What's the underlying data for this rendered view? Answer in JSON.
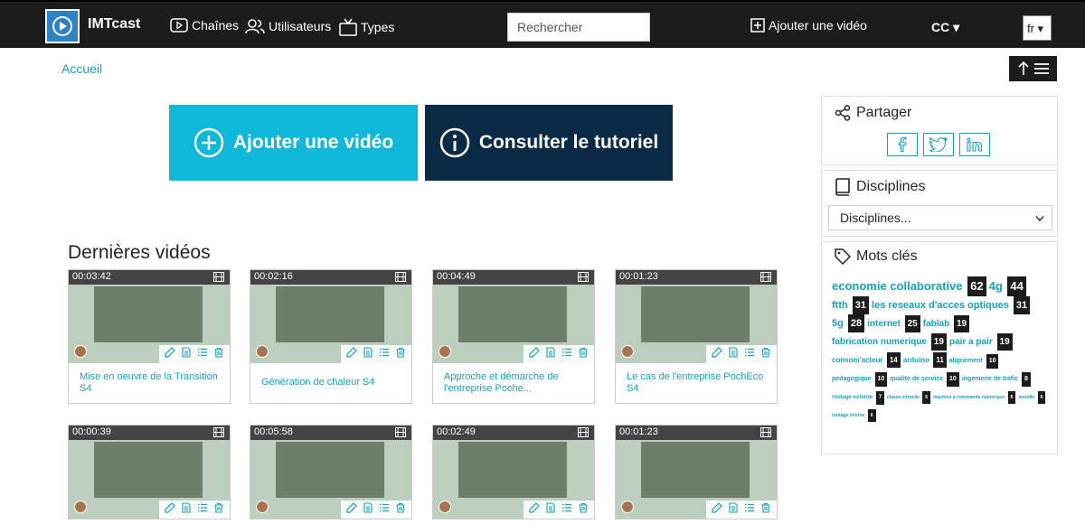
{
  "navbar": {
    "brand": "IMTcast",
    "items": [
      {
        "label": "Chaînes",
        "icon": "play-icon"
      },
      {
        "label": "Utilisateurs",
        "icon": "users-icon"
      },
      {
        "label": "Types",
        "icon": "tv-icon"
      }
    ],
    "search_placeholder": "Rechercher",
    "add_video": "Ajouter une vidéo",
    "cc": "CC ▾",
    "lang": "fr ▾"
  },
  "breadcrumb": "Accueil",
  "buttons": {
    "add": "Ajouter une vidéo",
    "tutorial": "Consulter le tutoriel"
  },
  "section_title": "Dernières vidéos",
  "videos": [
    {
      "duration": "00:03:42",
      "title": "Mise en oeuvre de la Transition S4"
    },
    {
      "duration": "00:02:16",
      "title": "Génération de chaleur S4"
    },
    {
      "duration": "00:04:49",
      "title": "Approche et démarche de l'entreprise Poche..."
    },
    {
      "duration": "00:01:23",
      "title": "Le cas de l'entreprise PochEco S4"
    },
    {
      "duration": "00:00:39",
      "title": ""
    },
    {
      "duration": "00:05:58",
      "title": ""
    },
    {
      "duration": "00:02:49",
      "title": ""
    },
    {
      "duration": "00:01:23",
      "title": ""
    }
  ],
  "sidebar": {
    "share_title": "Partager",
    "share_icons": [
      "facebook-icon",
      "twitter-icon",
      "linkedin-icon"
    ],
    "disciplines_title": "Disciplines",
    "disciplines_select": "Disciplines...",
    "keywords_title": "Mots clés",
    "keywords": [
      {
        "label": "economie collaborative",
        "count": "62",
        "size": 13
      },
      {
        "label": "4g",
        "count": "44",
        "size": 13
      },
      {
        "label": "ftth",
        "count": "31",
        "size": 11
      },
      {
        "label": "les reseaux d'acces optiques",
        "count": "31",
        "size": 11
      },
      {
        "label": "5g",
        "count": "28",
        "size": 11
      },
      {
        "label": "internet",
        "count": "25",
        "size": 10
      },
      {
        "label": "fablab",
        "count": "19",
        "size": 10
      },
      {
        "label": "fabrication numerique",
        "count": "19",
        "size": 10
      },
      {
        "label": "pair a pair",
        "count": "19",
        "size": 10
      },
      {
        "label": "consom'acteur",
        "count": "14",
        "size": 8
      },
      {
        "label": "arduino",
        "count": "11",
        "size": 8
      },
      {
        "label": "alignement",
        "count": "10",
        "size": 7
      },
      {
        "label": "pedagogique",
        "count": "10",
        "size": 7
      },
      {
        "label": "qualite de service",
        "count": "10",
        "size": 7
      },
      {
        "label": "ingenierie de trafic",
        "count": "8",
        "size": 7
      },
      {
        "label": "routage externe",
        "count": "7",
        "size": 6
      },
      {
        "label": "classe virtuelle",
        "count": "6",
        "size": 5
      },
      {
        "label": "machine a commande numerique",
        "count": "6",
        "size": 5
      },
      {
        "label": "moodle",
        "count": "6",
        "size": 5
      },
      {
        "label": "routage interne",
        "count": "6",
        "size": 5
      }
    ]
  },
  "colors": {
    "accent": "#17a2b8",
    "add_button": "#0fb8d9",
    "tutorial_button": "#0b2a45",
    "navbar": "#1c1c1c"
  }
}
